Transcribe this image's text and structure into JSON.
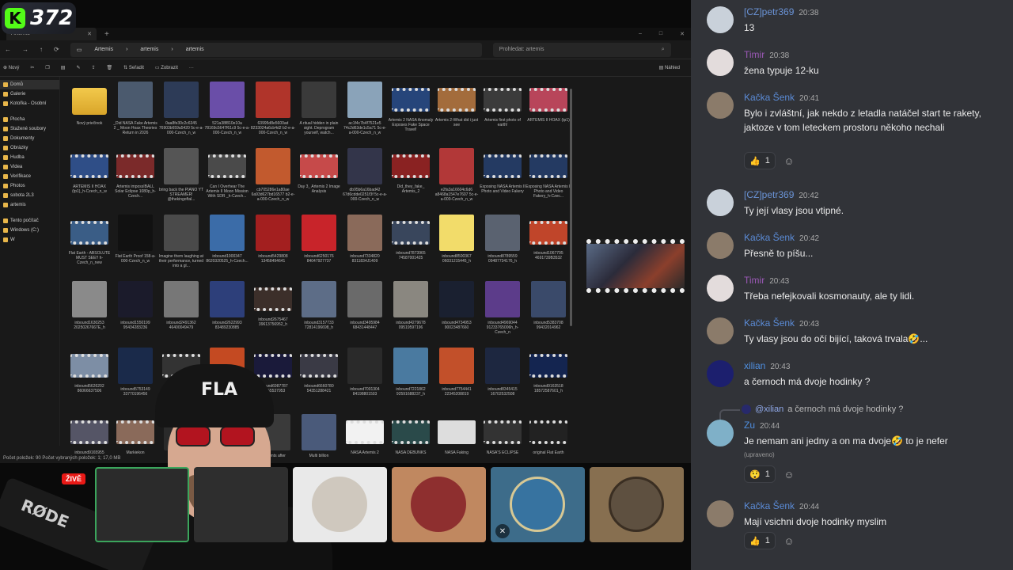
{
  "overlay": {
    "badge_count": "372",
    "badge_letter": "K",
    "live_label": "ŽIVĚ",
    "mic_brand": "RØDE",
    "cap_text": "FLA"
  },
  "explorer": {
    "tab_title": "Artemis",
    "breadcrumb": [
      "Artemis",
      "artemis",
      "artemis"
    ],
    "search_placeholder": "Prohledat: artemis",
    "cmd": {
      "new": "Nový",
      "sort": "Seřadit",
      "view": "Zobrazit",
      "preview": "Náhled"
    },
    "nav": [
      "Domů",
      "Galerie",
      "Kotořka - Osobní",
      "Plocha",
      "Stažené soubory",
      "Dokumenty",
      "Obrázky",
      "Hudba",
      "Videa",
      "Verifikace",
      "Photos",
      "sobota 2L3",
      "artemis",
      "Tento počítač",
      "Windows (C:)",
      "W"
    ],
    "status": "Počet položek: 90   Počet vybraných položek: 1; 17,0 MB",
    "files": [
      {
        "label": "Nový priečinok",
        "kind": "folder"
      },
      {
        "label": "_Did NASA Fake Artemis 2 _ Moon Hoax Theories Return in 2026",
        "kind": "img",
        "color": "#4b5a6e"
      },
      {
        "label": "0aa8fe30c2c6345 76903b659a5420 5c-e-a-000-Czech_n_w",
        "kind": "img",
        "color": "#2d3b57"
      },
      {
        "label": "521a38f810e10a 78169c5647f61c9 5c-e-a-000-Czech_n_w",
        "kind": "img",
        "color": "#6a4ea8"
      },
      {
        "label": "63995d8e5600ad 8233024a6cb4d2 b2-e-a-000-Czech_n_w",
        "kind": "img",
        "color": "#b0342a"
      },
      {
        "label": "A ritual hidden in plain sight. Deprogram yourself, watch...",
        "kind": "img",
        "color": "#3a3a3a"
      },
      {
        "label": "ac1f4c7b4f7521e5 74c2d63de1c5a71 5c-e-a-000-Czech_n_w",
        "kind": "img",
        "color": "#8aa3b9"
      },
      {
        "label": "Artemis 2 NASA Anomaly Exposes Fake Space Travel!",
        "kind": "vid",
        "color": "#26457a"
      },
      {
        "label": "Artemis 2-What did i just see",
        "kind": "vid",
        "color": "#a36c3c"
      },
      {
        "label": "Artemis first photo of earth!",
        "kind": "vid",
        "color": "#3b3b3b"
      },
      {
        "label": "ARTEMIS II HOAX (tp1)",
        "kind": "vid",
        "color": "#b8455a"
      },
      {
        "label": "ARTEMIS II HOAX (tp1)_h-Czech_n_w",
        "kind": "vid",
        "color": "#2f4e87"
      },
      {
        "label": "Artemis impossIBALL Solar Eclipse 1080p_h-Czech...",
        "kind": "vid",
        "color": "#7b2a2a"
      },
      {
        "label": "bring back the PIANO YT STREAMER! @thekingoftal...",
        "kind": "img",
        "color": "#555555"
      },
      {
        "label": "Can I Overhear The Artemis II Moon Mission With SDR _h-Czech...",
        "kind": "vid",
        "color": "#4a4a4a"
      },
      {
        "label": "cb705286e1a80ae 6a93d627bd16577 b2-e-a-000-Czech_n_w",
        "kind": "img",
        "color": "#c25a2e"
      },
      {
        "label": "Day 3_ Artemis 2 Image Analysis",
        "kind": "vid",
        "color": "#c64a4a"
      },
      {
        "label": "db95b6a16bad42 67d6cdde0251f3f 5c-e-a-000-Czech_n_w",
        "kind": "img",
        "color": "#33354a"
      },
      {
        "label": "Did_they_fake_ Artemis_2",
        "kind": "vid",
        "color": "#8a2222"
      },
      {
        "label": "e2fa3a16604c6d6 a8468a1547e7607 5c-e-a-000-Czech_n_w",
        "kind": "img",
        "color": "#b23838"
      },
      {
        "label": "Exposing NASA Artemis II Photo and Video Fakery",
        "kind": "vid",
        "color": "#243a62"
      },
      {
        "label": "Exposing NASA Artemis II Photo and Video Fakery_h-Czec...",
        "kind": "vid",
        "color": "#243a62"
      },
      {
        "label": "Flat Earth - ABSOLUTE MUST SEE!! h-Czech_n_new",
        "kind": "vid",
        "color": "#3a5d86"
      },
      {
        "label": "Flat Earth Proof 158-a-000-Czech_n_w",
        "kind": "img",
        "color": "#111111"
      },
      {
        "label": "Imagine them laughing at their performance, turned into a gl...",
        "kind": "img",
        "color": "#4a4a4a"
      },
      {
        "label": "inbound1900347 8620320525_h-Czech...",
        "kind": "img",
        "color": "#3b6ca8"
      },
      {
        "label": "inbound5429808 13458494641",
        "kind": "img",
        "color": "#a31f1f"
      },
      {
        "label": "inbound6250176 84047927737",
        "kind": "img",
        "color": "#c8242a"
      },
      {
        "label": "inbound7334820 8311834J1409",
        "kind": "img",
        "color": "#8a6a5a"
      },
      {
        "label": "inbound7873965 74587001425",
        "kind": "vid",
        "color": "#39465c"
      },
      {
        "label": "inbound8500367 06031215445_h",
        "kind": "img",
        "color": "#f2dc6a"
      },
      {
        "label": "inbound8789559 09487734176_h",
        "kind": "img",
        "color": "#5a6270"
      },
      {
        "label": "inbound1067795 4691739B3532",
        "kind": "vid",
        "color": "#c0452a"
      },
      {
        "label": "inbound1630253 20250267667E_h",
        "kind": "img",
        "color": "#8a8a8a"
      },
      {
        "label": "inbound1550199 95434283236",
        "kind": "img",
        "color": "#1b1b2b"
      },
      {
        "label": "inbound2491362 46400049479",
        "kind": "img",
        "color": "#777777"
      },
      {
        "label": "inbound2622993 83489230885",
        "kind": "img",
        "color": "#2d3f7a"
      },
      {
        "label": "inbound2675467 39613756952_h",
        "kind": "vid",
        "color": "#3c2f2a"
      },
      {
        "label": "inbound3157733 72814196698_h",
        "kind": "img",
        "color": "#5d6d87"
      },
      {
        "label": "inbound3495984 68431448447",
        "kind": "img",
        "color": "#6a6a6a"
      },
      {
        "label": "inbound4279678 09519597196",
        "kind": "img",
        "color": "#8a8780"
      },
      {
        "label": "inbound4734953 90023487660",
        "kind": "img",
        "color": "#1a2030"
      },
      {
        "label": "inbound4969044 91233765006h_h-Czech_n",
        "kind": "img",
        "color": "#5c3c8a"
      },
      {
        "label": "inbound5383708 99432014962",
        "kind": "img",
        "color": "#3a4a6a"
      },
      {
        "label": "inbound5626202 86066637506",
        "kind": "vid",
        "color": "#7d8ea5"
      },
      {
        "label": "inbound5753149 33770196456",
        "kind": "img",
        "color": "#1a2a4a"
      },
      {
        "label": "inbound5790",
        "kind": "vid",
        "color": "#333333"
      },
      {
        "label": "inbound6400",
        "kind": "img",
        "color": "#c44a22"
      },
      {
        "label": "inbound6987787 61265537953",
        "kind": "vid",
        "color": "#1a1a3a"
      },
      {
        "label": "inbound6660780 54351288421",
        "kind": "vid",
        "color": "#3a3a45"
      },
      {
        "label": "inbound7001304 84198801503",
        "kind": "img",
        "color": "#2a2a2a"
      },
      {
        "label": "inbound7221862 92591688237_h",
        "kind": "img",
        "color": "#4a7aa0"
      },
      {
        "label": "inbound7754441 22345208819",
        "kind": "img",
        "color": "#c2502a"
      },
      {
        "label": "inbound8345415 16702532508",
        "kind": "img",
        "color": "#1d2740"
      },
      {
        "label": "inbound9163518 18572587601_h",
        "kind": "vid",
        "color": "#142550"
      },
      {
        "label": "inbound9165955",
        "kind": "vid",
        "color": "#555566"
      },
      {
        "label": "Markiekon",
        "kind": "vid",
        "color": "#8a6a5a"
      },
      {
        "label": "",
        "kind": "img",
        "color": "#2a2a2a"
      },
      {
        "label": "",
        "kind": "img",
        "color": "#2a2a2a"
      },
      {
        "label": "Moments after",
        "kind": "img",
        "color": "#3a3a3a"
      },
      {
        "label": "Multi billion",
        "kind": "img",
        "color": "#4a5a7a"
      },
      {
        "label": "NASA Artemis 2",
        "kind": "vid",
        "color": "#f2f2f2"
      },
      {
        "label": "NASA DEBUNKS",
        "kind": "vid",
        "color": "#2a4a4a"
      },
      {
        "label": "NASA Faking",
        "kind": "vid",
        "color": "#dddddd"
      },
      {
        "label": "NASA'S ECLIPSE",
        "kind": "vid",
        "color": "#333333"
      },
      {
        "label": "original Flat Earth",
        "kind": "vid",
        "color": "#222222"
      }
    ]
  },
  "chat": {
    "messages": [
      {
        "user": "[CZ]petr369",
        "time": "20:38",
        "text": "13",
        "color": "#6a93d6",
        "avatar": "#c9d1da"
      },
      {
        "user": "Timir",
        "time": "20:38",
        "text": "žena typuje 12-ku",
        "color": "#9b59b6",
        "avatar": "#e3dcdc"
      },
      {
        "user": "Kačka Šenk",
        "time": "20:41",
        "text": "Bylo i zvláštní, jak nekdo z letadla natáčel start te rakety, jaktoze v tom leteckem prostoru někoho nechali",
        "color": "#5b8bd6",
        "avatar": "#8b7b6a",
        "reaction": {
          "emoji": "👍",
          "count": "1"
        }
      },
      {
        "user": "[CZ]petr369",
        "time": "20:42",
        "text": "Ty její vlasy jsou vtipné.",
        "color": "#6a93d6",
        "avatar": "#c9d1da"
      },
      {
        "user": "Kačka Šenk",
        "time": "20:42",
        "text": "Přesně to píšu...",
        "color": "#5b8bd6",
        "avatar": "#8b7b6a"
      },
      {
        "user": "Timir",
        "time": "20:43",
        "text": "Třeba nefejkovali kosmonauty, ale ty lidi.",
        "color": "#9b59b6",
        "avatar": "#e3dcdc"
      },
      {
        "user": "Kačka Šenk",
        "time": "20:43",
        "text": "Ty vlasy jsou do očí bijící, taková trvala🤣...",
        "color": "#5b8bd6",
        "avatar": "#8b7b6a"
      },
      {
        "user": "xilian",
        "time": "20:43",
        "text": "a černoch má dvoje hodinky ?",
        "color": "#4f8fe0",
        "avatar": "#1c1f6e"
      },
      {
        "user": "Zu",
        "time": "20:44",
        "text": "Je nemam ani jedny a on ma dvoje🤣 to je nefer",
        "color": "#4f8fe0",
        "avatar": "#7fb0c8",
        "edited": "(upraveno)",
        "reaction": {
          "emoji": "😲",
          "count": "1"
        }
      },
      {
        "user": "Kačka Šenk",
        "time": "20:44",
        "text": "Mají vsichni dvoje hodinky myslim",
        "color": "#5b8bd6",
        "avatar": "#8b7b6a",
        "reaction": {
          "emoji": "👍",
          "count": "1"
        }
      }
    ],
    "reply": {
      "user": "@xilian",
      "text": "a černoch má dvoje hodinky ?"
    }
  }
}
